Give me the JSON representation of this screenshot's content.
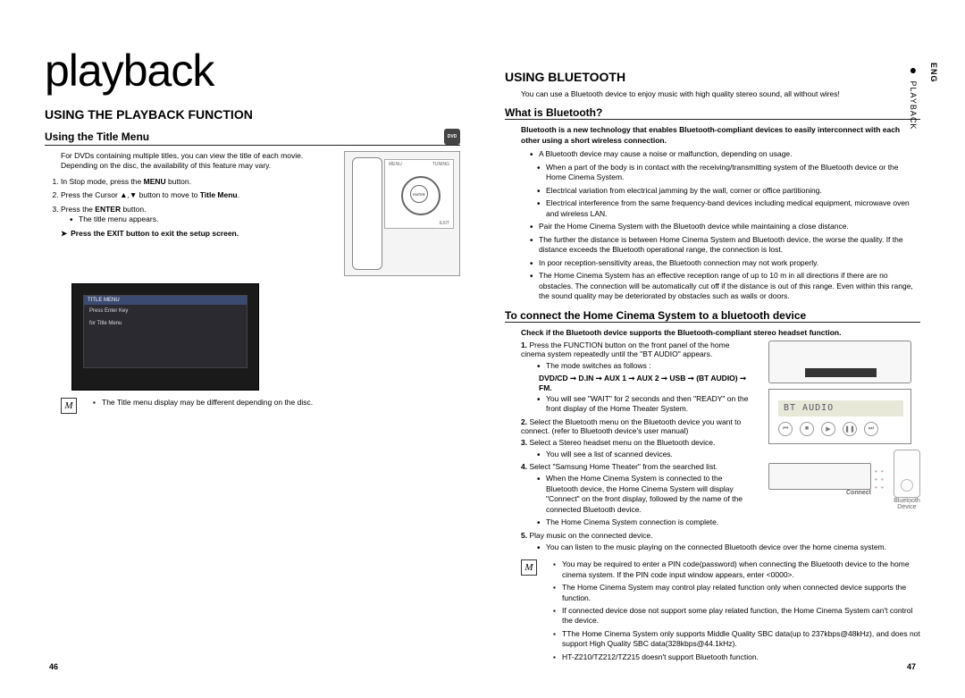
{
  "leftPage": {
    "bigTitle": "playback",
    "h1": "USING THE PLAYBACK FUNCTION",
    "titleMenu": {
      "heading": "Using the Title Menu",
      "badge": "DVD",
      "intro": "For DVDs containing multiple titles, you can view the title of each movie. Depending on the disc, the availability of this feature may vary.",
      "steps": [
        {
          "pre": "In Stop mode, press the ",
          "bold": "MENU",
          "post": " button."
        },
        {
          "pre": "Press the Cursor ▲,▼ button to move to ",
          "bold": "Title Menu",
          "post": "."
        },
        {
          "pre": "Press the ",
          "bold": "ENTER",
          "post": " button."
        }
      ],
      "stepNote": "The title menu appears.",
      "exitLine": "Press the EXIT button to exit the setup screen.",
      "screenshotLabels": {
        "title": "TITLE MENU",
        "row1": "Press Enter Key",
        "row2": "for Title Menu"
      },
      "remote": {
        "menu": "MENU",
        "enter": "ENTER",
        "tuning": "TUNING",
        "exit": "EXIT"
      },
      "note": "The Title menu display may be different depending on the disc."
    },
    "pageNum": "46"
  },
  "rightPage": {
    "h1": "USING BLUETOOTH",
    "intro": "You can use a Bluetooth device to enjoy music with high quality stereo sound, all without wires!",
    "whatIs": {
      "heading": "What is Bluetooth?",
      "boldIntro": "Bluetooth is a new technology that enables Bluetooth-compliant devices to easily interconnect with each other using a short wireless connection.",
      "bullets": [
        "A Bluetooth device may cause a noise or malfunction, depending on usage.",
        "Pair the Home Cinema System with the Bluetooth device while maintaining a close distance.",
        "The further the distance is between Home Cinema System and Bluetooth device, the worse the quality. If the distance exceeds the Bluetooth operational range, the connection is lost.",
        "In poor reception-sensitivity areas, the Bluetooth connection may not work properly.",
        "The Home Cinema System has an effective reception range of up to 10 m in all directions if there are no obstacles. The connection will be automatically cut off if the distance is out of this range. Even within this range, the sound quality may be deteriorated by obstacles such as walls or doors."
      ],
      "subBullets1": [
        "When a part of the body is in contact with the receiving/transmitting system of the Bluetooth device or the Home Cinema System.",
        "Electrical variation from electrical jamming by the wall, corner or office partitioning.",
        "Electrical interference from the same frequency-band devices including medical equipment, microwave oven and wireless LAN."
      ]
    },
    "connect": {
      "heading": "To connect the Home Cinema System to a bluetooth device",
      "checkLine": "Check if the Bluetooth device supports the Bluetooth-compliant stereo headset function.",
      "display": "BT AUDIO",
      "connectWord": "Connect",
      "btDeviceLabel": "Bluetooth Device",
      "steps": [
        {
          "num": "1.",
          "text": "Press the FUNCTION button on the front panel of the home cinema system repeatedly until the \"BT AUDIO\" appears.",
          "sub": [
            "The mode switches as follows :",
            "You will see \"WAIT\" for 2 seconds and then \"READY\" on the front display of the Home Theater System."
          ],
          "modeLine": "DVD/CD ➞ D.IN ➞ AUX 1 ➞ AUX 2 ➞ USB ➞ (BT AUDIO) ➞ FM."
        },
        {
          "num": "2.",
          "text": "Select the Bluetooth menu on the Bluetooth device you want to connect. (refer to Bluetooth device's user manual)"
        },
        {
          "num": "3.",
          "text": "Select a Stereo headset menu on the Bluetooth device.",
          "sub": [
            "You will see a list of scanned devices."
          ]
        },
        {
          "num": "4.",
          "text": "Select \"Samsung Home Theater\" from the searched list.",
          "sub": [
            "When the Home Cinema System is connected to the Bluetooth device, the Home Cinema System will display \"Connect\" on the front display, followed by the name of the connected Bluetooth device.",
            "The Home Cinema System connection is complete."
          ]
        },
        {
          "num": "5.",
          "text": "Play music on the connected device.",
          "sub": [
            "You can listen to the music playing on the connected Bluetooth device over the home cinema system."
          ]
        }
      ],
      "notes": [
        "You may be required to enter a PIN code(password) when connecting the Bluetooth device to the home cinema system. If the PIN code input window appears, enter <0000>.",
        "The Home Cinema System may control play related function  only when connected device supports the function.",
        "If connected device dose not support some play related function, the Home Cinema System can't control the device.",
        "TThe Home Cinema System only supports Middle Quality SBC data(up to 237kbps@48kHz), and does not support High Quality SBC data(328kbps@44.1kHz).",
        "HT-Z210/TZ212/TZ215 doesn't support Bluetooth function."
      ]
    },
    "pageNum": "47"
  },
  "sideTab": {
    "eng": "ENG",
    "section": "PLAYBACK"
  }
}
